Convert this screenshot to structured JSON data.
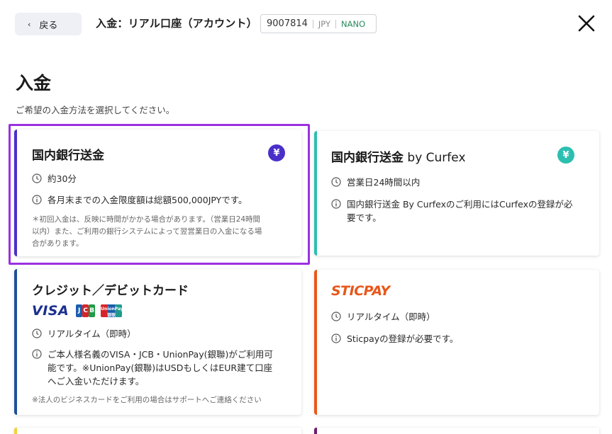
{
  "header": {
    "back_label": "戻る",
    "page_heading": "入金：リアル口座（アカウント）",
    "account": {
      "number": "9007814",
      "currency": "JPY",
      "type": "NANO"
    }
  },
  "title": "入金",
  "subtitle": "ご希望の入金方法を選択してください。",
  "cards": [
    {
      "title": "国内銀行送金",
      "coin": "¥",
      "accent": "#4b2fc9",
      "time": "約30分",
      "info": "各月末までの入金限度額は総額500,000JPYです。",
      "note_lines": [
        "＊初回入金は、反映に時間がかかる場合があります。（営業日24時間",
        "以内）また、ご利用の銀行システムによって翌営業日の入金になる場",
        "合があります。"
      ],
      "selected": true
    },
    {
      "title_main": "国内銀行送金",
      "title_suffix": " by Curfex",
      "coin": "¥",
      "accent": "#2bbfb0",
      "time": "営業日24時間以内",
      "info_lines": [
        "国内銀行送金 By Curfexのご利用にはCurfexの登録が必",
        "要です。"
      ]
    },
    {
      "title": "クレジット／デビットカード",
      "accent": "#1f4e9b",
      "logos": {
        "visa": "VISA",
        "jcb": [
          "J",
          "C",
          "B"
        ],
        "unionpay": "UnionPay 银联"
      },
      "time": "リアルタイム（即時）",
      "info_lines": [
        "ご本人様名義のVISA・JCB・UnionPay(銀聯)がご利用可",
        "能です。※UnionPay(銀聯)はUSDもしくはEUR建て口座",
        "へご入金いただけます。"
      ],
      "note": "※法人のビジネスカードをご利用の場合はサポートへご連絡ください"
    },
    {
      "logo_text": "STICPAY",
      "accent": "#e8571a",
      "time": "リアルタイム（即時）",
      "info": "Sticpayの登録が必要です。"
    }
  ],
  "colors": {
    "selected_border": "#9b30e0",
    "peek_left": "#f2d23c",
    "peek_right": "#6b1f6b"
  }
}
